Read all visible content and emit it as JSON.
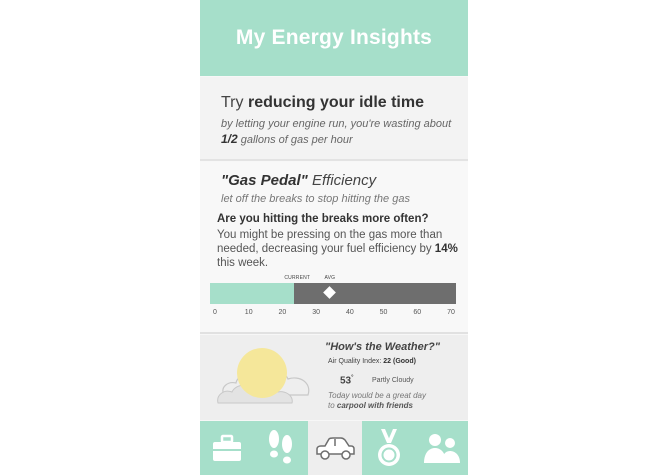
{
  "header": {
    "title": "My Energy Insights"
  },
  "idle": {
    "title_prefix": "Try",
    "title_bold": "reducing your idle time",
    "sub_part1": "by letting your engine run, you're wasting about",
    "sub_bold": "1/2",
    "sub_part2": "gallons of gas per hour"
  },
  "gas": {
    "title_bold": "\"Gas Pedal\"",
    "title_rest": "Efficiency",
    "subtitle": "let off the breaks to stop hitting the gas",
    "question": "Are you hitting the breaks more often?",
    "body_part1": "You might be pressing on the gas more than needed, decreasing your fuel efficiency by",
    "body_bold": "14%",
    "body_part2": "this week.",
    "bar": {
      "current_label": "CURRENT",
      "avg_label": "AVG",
      "current_value": 24,
      "avg_value": 34,
      "min": 0,
      "max": 70,
      "ticks": [
        "0",
        "10",
        "20",
        "30",
        "40",
        "50",
        "60",
        "70"
      ]
    }
  },
  "weather": {
    "title": "\"How's the Weather?\"",
    "air_quality_label": "Air Quality Index:",
    "air_quality_value": "22 (Good)",
    "temperature": "53",
    "degree": "°",
    "condition": "Partly Cloudy",
    "today_line1": "Today would be a great day",
    "today_line2_prefix": "to",
    "today_line2_bold": "carpool with friends"
  },
  "tabs": [
    {
      "icon": "briefcase-icon",
      "selected": false
    },
    {
      "icon": "footprints-icon",
      "selected": false
    },
    {
      "icon": "car-icon",
      "selected": true
    },
    {
      "icon": "medal-icon",
      "selected": false
    },
    {
      "icon": "people-icon",
      "selected": false
    }
  ],
  "colors": {
    "accent": "#a6dfca",
    "bar_dark": "#6e6e6e",
    "sun": "#f5e79a"
  }
}
